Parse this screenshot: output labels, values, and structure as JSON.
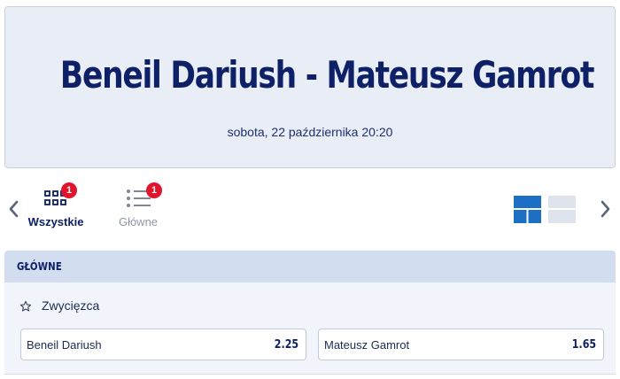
{
  "event": {
    "title": "Beneil Dariush - Mateusz Gamrot",
    "date": "sobota, 22 października 20:20"
  },
  "tabs": [
    {
      "label": "Wszystkie",
      "badge": "1",
      "active": true,
      "icon": "grid-icon"
    },
    {
      "label": "Główne",
      "badge": "1",
      "active": false,
      "icon": "list-icon"
    }
  ],
  "section": {
    "title": "GŁÓWNE"
  },
  "market": {
    "name": "Zwycięzca",
    "icon": "star-icon",
    "outcomes": [
      {
        "name": "Beneil Dariush",
        "odds": "2.25"
      },
      {
        "name": "Mateusz Gamrot",
        "odds": "1.65"
      }
    ]
  },
  "colors": {
    "brand_navy": "#0e2066",
    "badge_red": "#e0152c",
    "toggle_active": "#1d6fc4",
    "toggle_inactive": "#dfe4ec"
  }
}
